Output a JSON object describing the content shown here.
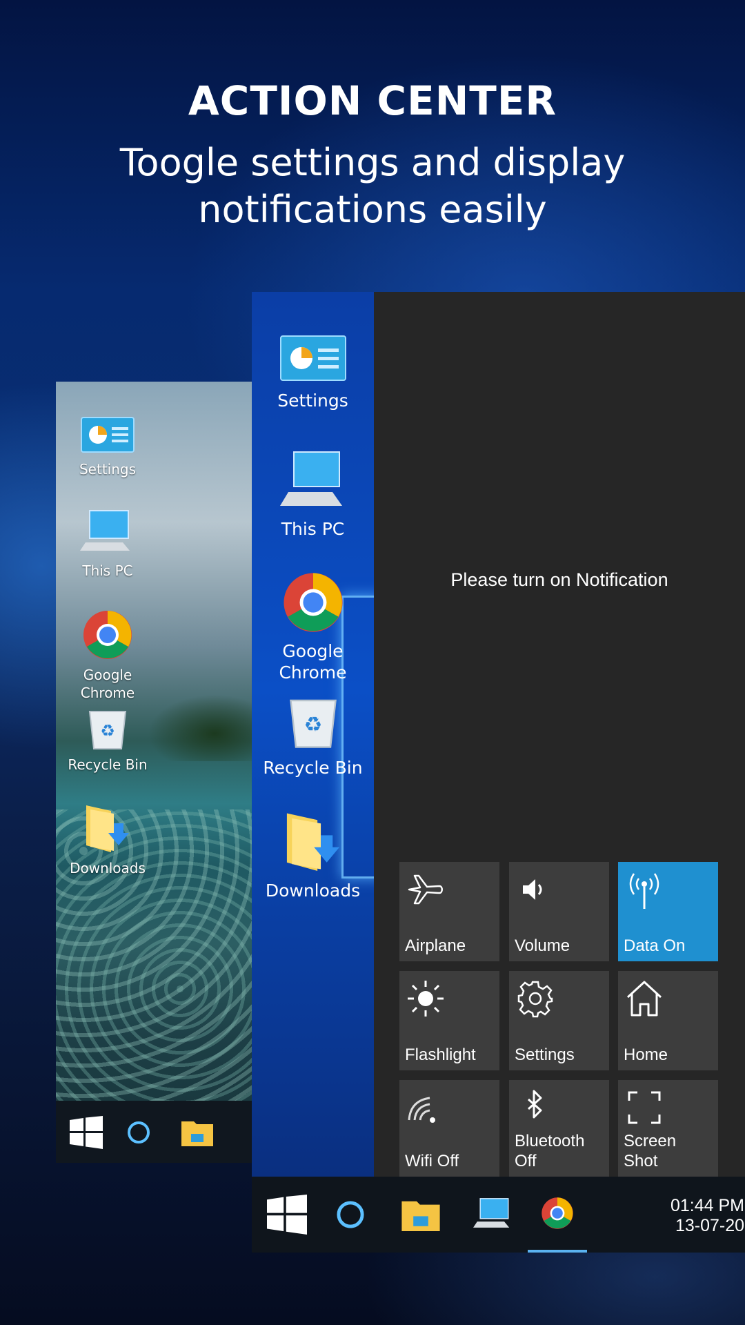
{
  "header": {
    "title": "ACTION CENTER",
    "subtitle_line1": "Toogle settings and display",
    "subtitle_line2": "notifications easily"
  },
  "back_phone": {
    "desktop_icons": [
      {
        "label": "Settings",
        "icon": "settings-app-icon"
      },
      {
        "label": "This PC",
        "icon": "computer-icon"
      },
      {
        "label": "Google Chrome",
        "icon": "chrome-icon"
      },
      {
        "label": "Recycle Bin",
        "icon": "recycle-bin-icon"
      },
      {
        "label": "Downloads",
        "icon": "downloads-folder-icon"
      }
    ]
  },
  "front_phone": {
    "desktop_icons": [
      {
        "label": "Settings",
        "icon": "settings-app-icon"
      },
      {
        "label": "This PC",
        "icon": "computer-icon"
      },
      {
        "label_line1": "Google",
        "label_line2": "Chrome",
        "icon": "chrome-icon"
      },
      {
        "label": "Recycle Bin",
        "icon": "recycle-bin-icon"
      },
      {
        "label": "Downloads",
        "icon": "downloads-folder-icon"
      }
    ],
    "notification_message": "Please turn on Notification",
    "quick_actions": [
      {
        "label": "Airplane",
        "icon": "airplane-icon",
        "active": false
      },
      {
        "label": "Volume",
        "icon": "volume-icon",
        "active": false
      },
      {
        "label": "Data On",
        "icon": "mobile-data-icon",
        "active": true
      },
      {
        "label": "Flashlight",
        "icon": "flashlight-icon",
        "active": false
      },
      {
        "label": "Settings",
        "icon": "gear-icon",
        "active": false
      },
      {
        "label": "Home",
        "icon": "home-icon",
        "active": false
      },
      {
        "label": "Wifi Off",
        "icon": "wifi-icon",
        "active": false
      },
      {
        "label_line1": "Bluetooth",
        "label_line2": "Off",
        "icon": "bluetooth-icon",
        "active": false
      },
      {
        "label_line1": "Screen",
        "label_line2": "Shot",
        "icon": "screenshot-icon",
        "active": false
      }
    ],
    "taskbar": {
      "items": [
        "start-icon",
        "cortana-icon",
        "file-explorer-icon",
        "this-pc-icon",
        "chrome-icon"
      ],
      "time": "01:44 PM",
      "date": "13-07-20"
    }
  },
  "colors": {
    "active_tile": "#1f90d0",
    "tile": "#3d3d3d",
    "panel": "#262626",
    "taskbar": "#0f151c"
  }
}
